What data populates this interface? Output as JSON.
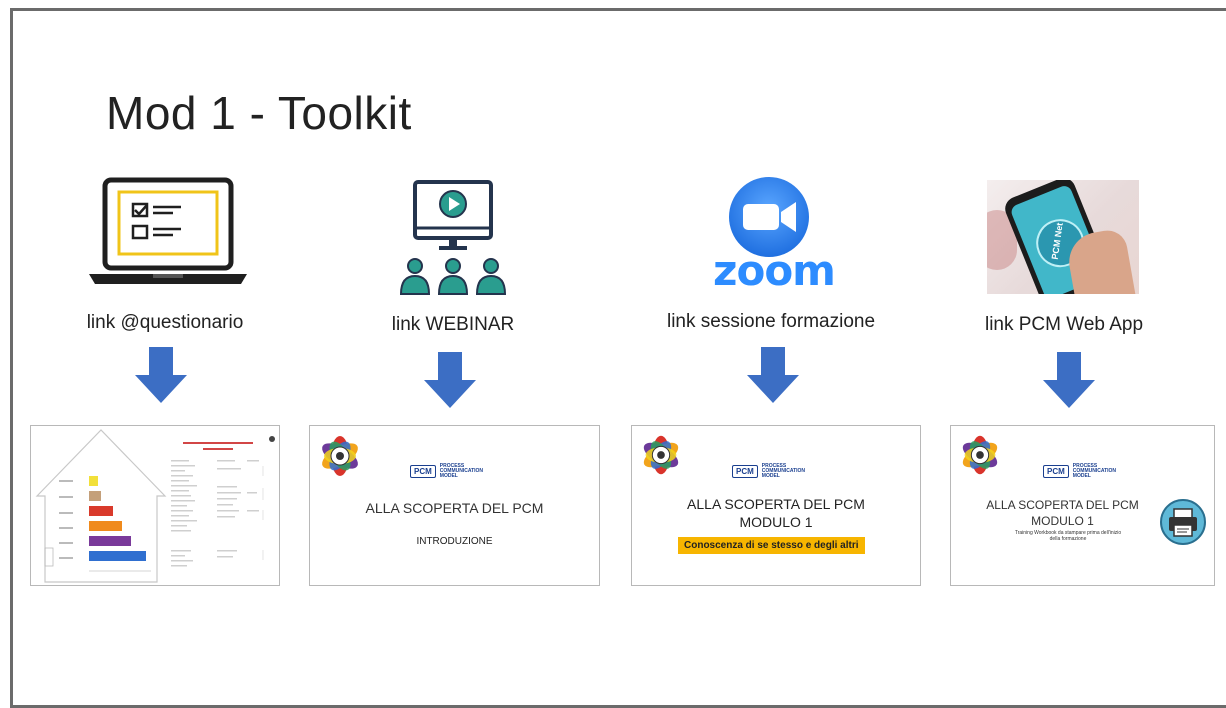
{
  "title": "Mod 1 - Toolkit",
  "items": [
    {
      "label": "link @questionario",
      "icon": "laptop-checklist-icon"
    },
    {
      "label": "link WEBINAR",
      "icon": "webinar-icon"
    },
    {
      "label": "link sessione formazione",
      "icon": "zoom-logo-icon",
      "logo_text": "zoom"
    },
    {
      "label": "link PCM Web App",
      "icon": "phone-app-photo",
      "screen_text": "PCM Net"
    }
  ],
  "slides": {
    "pcm_box": "PCM",
    "pcm_small": "PROCESS COMMUNICATION MODEL",
    "slide2_title": "ALLA SCOPERTA DEL PCM",
    "slide2_sub": "INTRODUZIONE",
    "slide3_title": "ALLA SCOPERTA DEL PCM",
    "slide3_module": "MODULO 1",
    "slide3_highlight": "Conoscenza di se stesso e degli altri",
    "slide4_title": "ALLA SCOPERTA DEL PCM",
    "slide4_module": "MODULO 1",
    "slide4_note": "Training Workbook da stampare prima dell'inizio della formazione"
  },
  "colors": {
    "arrow": "#3c6ec4",
    "zoom_blue": "#2d8cff",
    "teal": "#2a9d8f",
    "navy": "#24344d",
    "yellow": "#f0c419"
  },
  "bar_chart": {
    "values": [
      0.15,
      0.2,
      0.4,
      0.55,
      0.7,
      0.95
    ],
    "colors": [
      "#f2e03a",
      "#c4a07a",
      "#d93a2b",
      "#f08a1c",
      "#7a3a9a",
      "#2f6fd0"
    ]
  }
}
